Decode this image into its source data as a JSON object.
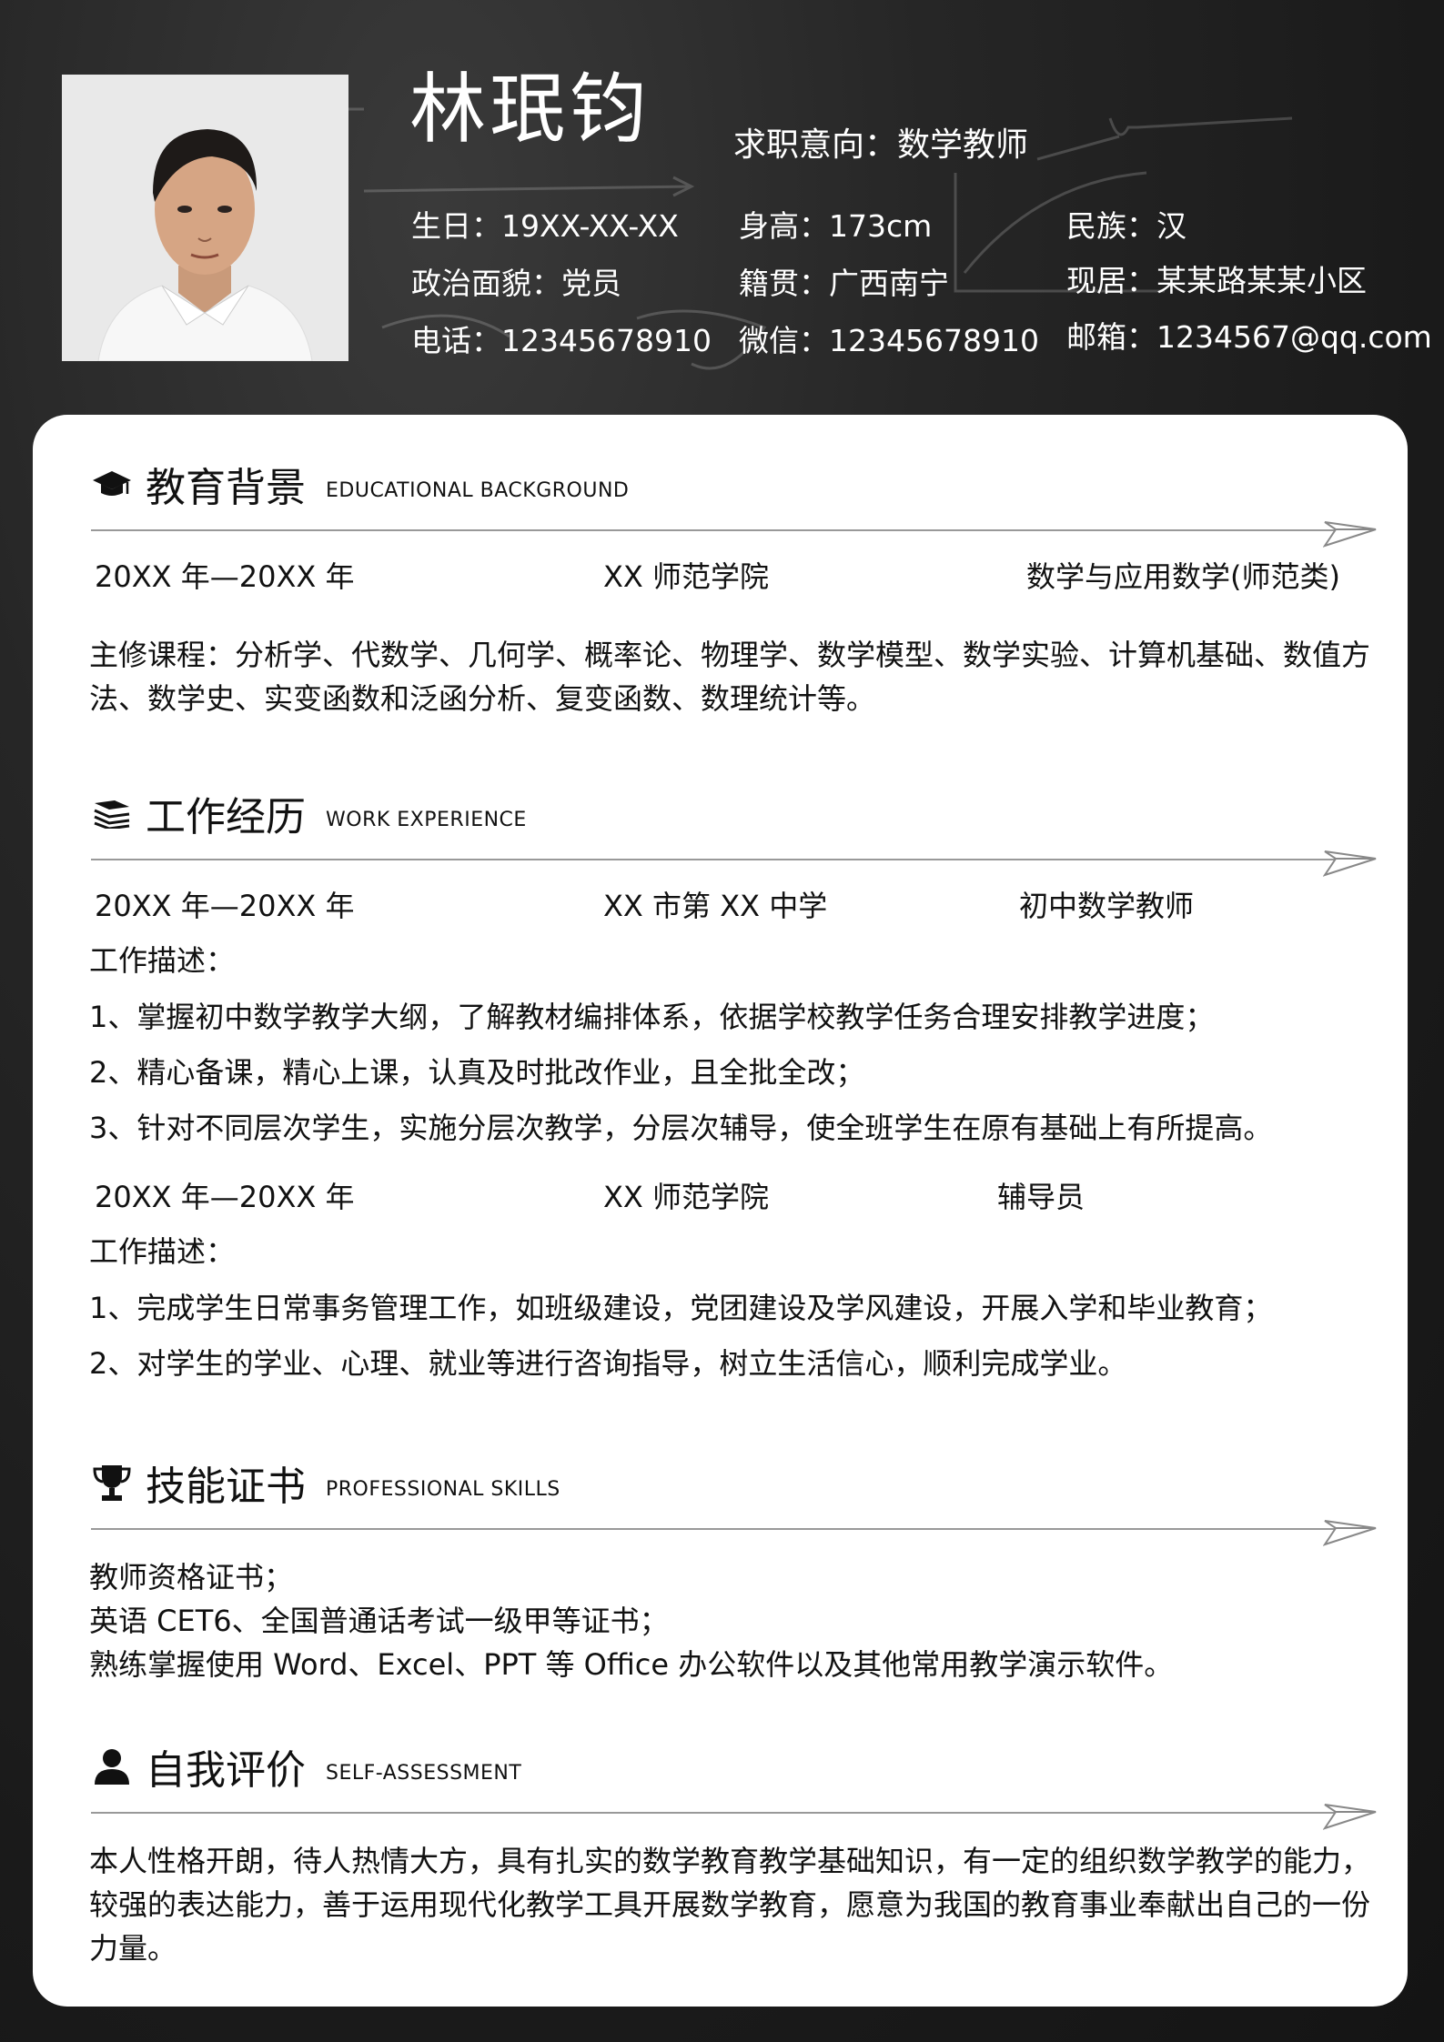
{
  "header": {
    "name": "林珉钧",
    "job_intent": "求职意向：数学教师",
    "info_rows": [
      [
        "生日：19XX-XX-XX",
        "身高：173cm",
        "民族：汉"
      ],
      [
        "政治面貌：党员",
        "籍贯：广西南宁",
        "现居：某某路某某小区"
      ],
      [
        "电话：12345678910",
        "微信：12345678910",
        "邮箱：1234567@qq.com"
      ]
    ]
  },
  "education": {
    "title": "教育背景",
    "title_en": "EDUCATIONAL BACKGROUND",
    "period": "20XX 年—20XX 年",
    "school": "XX 师范学院",
    "major": "数学与应用数学(师范类)",
    "courses": "主修课程：分析学、代数学、几何学、概率论、物理学、数学模型、数学实验、计算机基础、数值方法、数学史、实变函数和泛函分析、复变函数、数理统计等。"
  },
  "work": {
    "title": "工作经历",
    "title_en": "WORK EXPERIENCE",
    "jobs": [
      {
        "period": "20XX 年—20XX 年",
        "org": "XX 市第 XX 中学",
        "role": "初中数学教师",
        "desc_label": "工作描述：",
        "items": [
          "1、掌握初中数学教学大纲，了解教材编排体系，依据学校教学任务合理安排教学进度；",
          "2、精心备课，精心上课，认真及时批改作业，且全批全改；",
          "3、针对不同层次学生，实施分层次教学，分层次辅导，使全班学生在原有基础上有所提高。"
        ]
      },
      {
        "period": "20XX 年—20XX 年",
        "org": "XX 师范学院",
        "role": "辅导员",
        "desc_label": "工作描述：",
        "items": [
          "1、完成学生日常事务管理工作，如班级建设，党团建设及学风建设，开展入学和毕业教育；",
          "2、对学生的学业、心理、就业等进行咨询指导，树立生活信心，顺利完成学业。"
        ]
      }
    ]
  },
  "skills": {
    "title": "技能证书",
    "title_en": "PROFESSIONAL SKILLS",
    "items": [
      "教师资格证书；",
      "英语 CET6、全国普通话考试一级甲等证书；",
      "熟练掌握使用 Word、Excel、PPT 等 Office  办公软件以及其他常用教学演示软件。"
    ]
  },
  "self": {
    "title": "自我评价",
    "title_en": "SELF-ASSESSMENT",
    "text": "本人性格开朗，待人热情大方，具有扎实的数学教育教学基础知识，有一定的组织数学教学的能力，较强的表达能力，善于运用现代化教学工具开展数学教育，愿意为我国的教育事业奉献出自己的一份力量。"
  },
  "icons": {
    "education": "graduation-cap-icon",
    "work": "book-stack-icon",
    "skills": "trophy-icon",
    "self": "person-icon",
    "divider_end": "paper-plane-icon"
  },
  "colors": {
    "background": "#1c1c1c",
    "card": "#ffffff",
    "divider": "#999999"
  }
}
